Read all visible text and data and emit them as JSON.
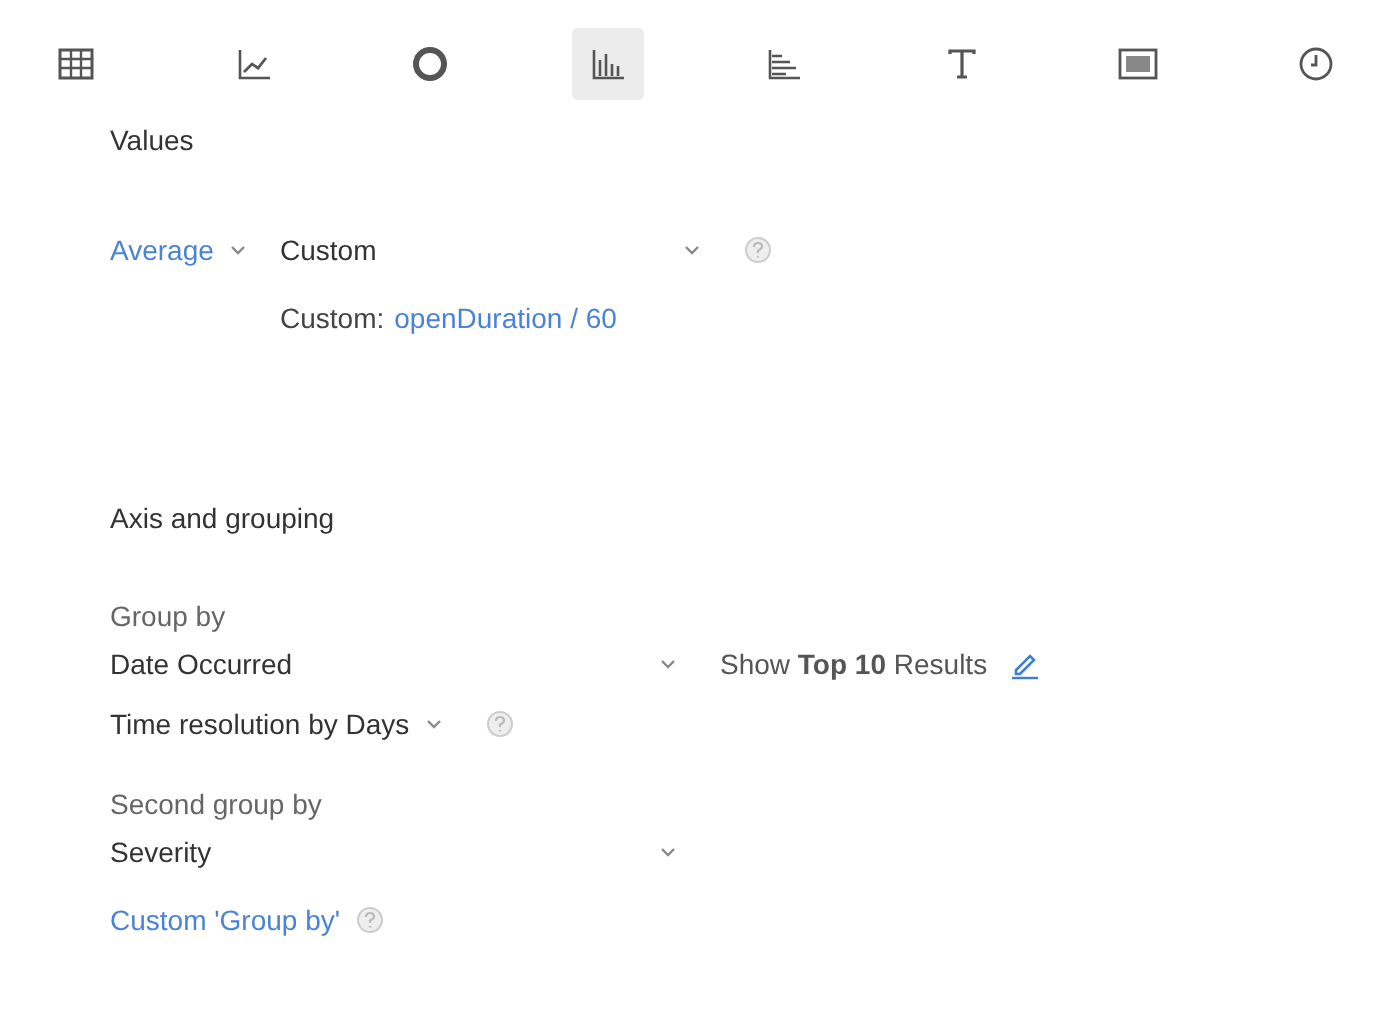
{
  "toolbar": [
    {
      "kind": "table",
      "selected": false
    },
    {
      "kind": "line",
      "selected": false
    },
    {
      "kind": "donut",
      "selected": false
    },
    {
      "kind": "bar",
      "selected": true
    },
    {
      "kind": "hbar",
      "selected": false
    },
    {
      "kind": "text",
      "selected": false
    },
    {
      "kind": "number",
      "selected": false
    },
    {
      "kind": "duration",
      "selected": false
    }
  ],
  "values": {
    "title": "Values",
    "aggregation": "Average",
    "function": "Custom",
    "custom_label": "Custom:",
    "custom_expression": "openDuration / 60"
  },
  "axis": {
    "title": "Axis and grouping",
    "group_by_label": "Group by",
    "group_by_value": "Date Occurred",
    "top_results": "Show **Top 10** Results",
    "time_resolution": "Time resolution by Days",
    "second_group_by_label": "Second group by",
    "second_group_by_value": "Severity",
    "custom_group_by": "Custom 'Group by'"
  }
}
